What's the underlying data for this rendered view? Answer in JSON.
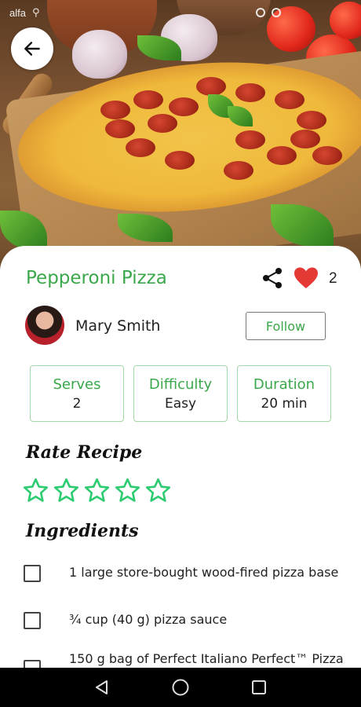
{
  "status_bar": {
    "carrier": "alfa"
  },
  "recipe": {
    "title": "Pepperoni Pizza",
    "likes": "2",
    "author": {
      "name": "Mary Smith",
      "follow_label": "Follow"
    },
    "stats": [
      {
        "label": "Serves",
        "value": "2"
      },
      {
        "label": "Difficulty",
        "value": "Easy"
      },
      {
        "label": "Duration",
        "value": "20 min"
      }
    ],
    "rate_heading": "Rate Recipe",
    "rating": {
      "value": 0,
      "max": 5
    },
    "ingredients_heading": "Ingredients",
    "ingredients": [
      {
        "text": "1 large store-bought wood-fired pizza base",
        "checked": false
      },
      {
        "text": "¾ cup (40 g) pizza sauce",
        "checked": false
      },
      {
        "text": "150 g bag of Perfect Italiano Perfect™ Pizza",
        "checked": false
      }
    ]
  },
  "colors": {
    "accent_green": "#3aa84a",
    "star_green": "#2ecc71",
    "heart_red": "#e53935",
    "stat_border": "#9fd9a7"
  },
  "icons": {
    "back": "arrow-left-icon",
    "share": "share-icon",
    "like": "heart-icon",
    "nav_back": "triangle-back-icon",
    "nav_home": "circle-home-icon",
    "nav_recents": "square-recents-icon"
  }
}
